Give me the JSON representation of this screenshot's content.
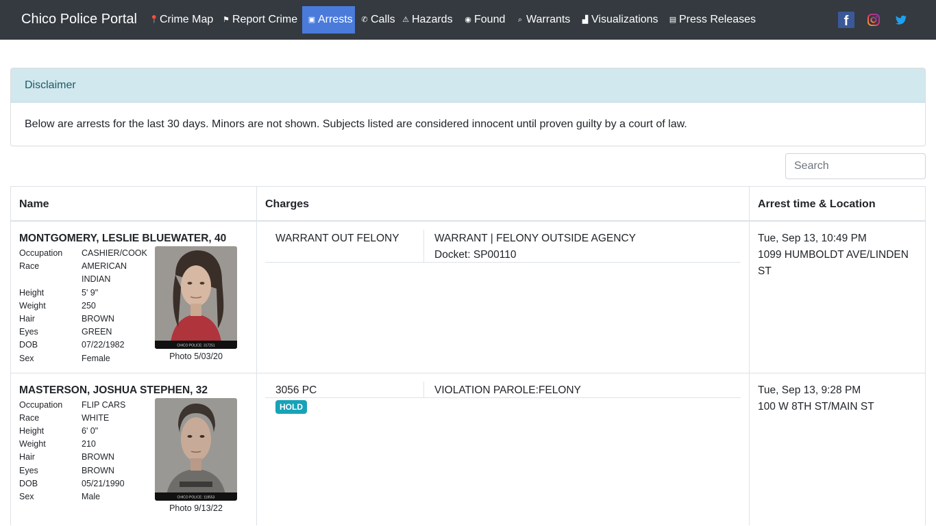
{
  "navbar": {
    "brand": "Chico Police Portal",
    "items": [
      {
        "label": "Crime Map",
        "icon": "map-marker-icon",
        "active": false
      },
      {
        "label": "Report Crime",
        "icon": "flag-icon",
        "active": false
      },
      {
        "label": "Arrests",
        "icon": "id-card-icon",
        "active": true
      },
      {
        "label": "Calls",
        "icon": "phone-icon",
        "active": false
      },
      {
        "label": "Hazards",
        "icon": "warning-icon",
        "active": false
      },
      {
        "label": "Found",
        "icon": "compass-icon",
        "active": false
      },
      {
        "label": "Warrants",
        "icon": "search-icon",
        "active": false
      },
      {
        "label": "Visualizations",
        "icon": "chart-icon",
        "active": false
      },
      {
        "label": "Press Releases",
        "icon": "newspaper-icon",
        "active": false
      }
    ],
    "social": [
      "facebook-icon",
      "instagram-icon",
      "twitter-icon"
    ]
  },
  "disclaimer": {
    "title": "Disclaimer",
    "text": "Below are arrests for the last 30 days. Minors are not shown. Subjects listed are considered innocent until proven guilty by a court of law."
  },
  "search": {
    "placeholder": "Search"
  },
  "table": {
    "headers": [
      "Name",
      "Charges",
      "Arrest time & Location"
    ],
    "rows": [
      {
        "name": "MONTGOMERY, LESLIE BLUEWATER, 40",
        "attrs": [
          {
            "label": "Occupation",
            "value": "CASHIER/COOK"
          },
          {
            "label": "Race",
            "value": "AMERICAN"
          },
          {
            "label": "",
            "value": "INDIAN"
          },
          {
            "label": "Height",
            "value": "5' 9\""
          },
          {
            "label": "Weight",
            "value": "250"
          },
          {
            "label": "Hair",
            "value": "BROWN"
          },
          {
            "label": "Eyes",
            "value": "GREEN"
          },
          {
            "label": "DOB",
            "value": "07/22/1982"
          },
          {
            "label": "Sex",
            "value": "Female"
          }
        ],
        "photo_caption": "Photo 5/03/20",
        "photo_label": "CHICO POLICE: 317251",
        "charges": [
          {
            "code": "WARRANT OUT FELONY",
            "description": "WARRANT | FELONY OUTSIDE AGENCY",
            "docket": "Docket: SP00110"
          }
        ],
        "badge": "",
        "time": "Tue, Sep 13, 10:49 PM",
        "location": "1099 HUMBOLDT AVE/LINDEN ST"
      },
      {
        "name": "MASTERSON, JOSHUA STEPHEN, 32",
        "attrs": [
          {
            "label": "Occupation",
            "value": "FLIP CARS"
          },
          {
            "label": "Race",
            "value": "WHITE"
          },
          {
            "label": "Height",
            "value": "6' 0\""
          },
          {
            "label": "Weight",
            "value": "210"
          },
          {
            "label": "Hair",
            "value": "BROWN"
          },
          {
            "label": "Eyes",
            "value": "BROWN"
          },
          {
            "label": "DOB",
            "value": "05/21/1990"
          },
          {
            "label": "Sex",
            "value": "Male"
          }
        ],
        "photo_caption": "Photo 9/13/22",
        "photo_label": "CHICO POLICE: 118553",
        "charges": [
          {
            "code": "3056 PC",
            "description": "VIOLATION PAROLE:FELONY",
            "docket": ""
          }
        ],
        "badge": "HOLD",
        "time": "Tue, Sep 13, 9:28 PM",
        "location": "100 W 8TH ST/MAIN ST"
      }
    ]
  }
}
